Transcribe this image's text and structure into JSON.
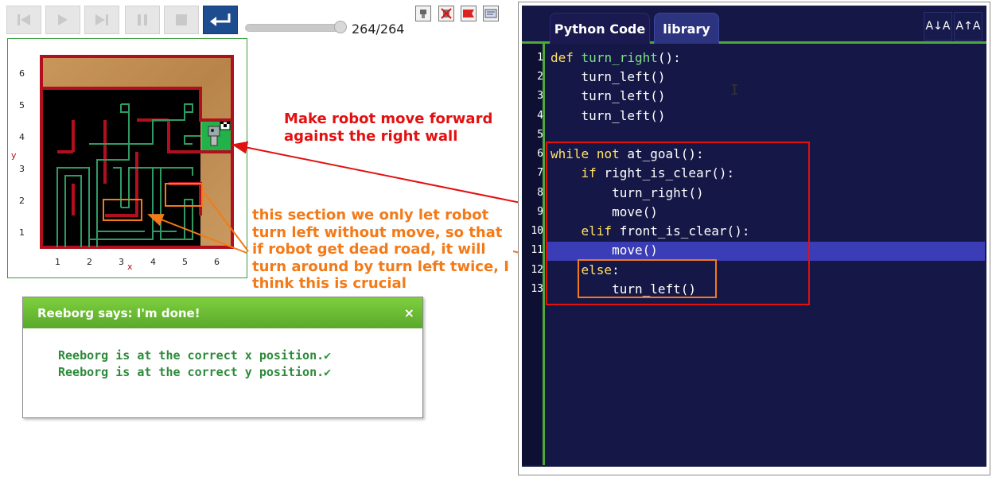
{
  "toolbar": {
    "buttons": [
      "reverse-step",
      "run",
      "step",
      "pause",
      "stop",
      "replay-enter"
    ],
    "slider": {
      "max": 264,
      "value": 264
    },
    "step_counter": "264/264",
    "mini_icons": [
      "robot-icon",
      "delete-robot-icon",
      "red-flag-icon",
      "world-info-icon"
    ]
  },
  "world": {
    "x_labels": [
      "1",
      "2",
      "3",
      "4",
      "5",
      "6"
    ],
    "y_labels": [
      "1",
      "2",
      "3",
      "4",
      "5",
      "6"
    ],
    "x_axis": "x",
    "y_axis": "y"
  },
  "annotations": {
    "red": [
      "Make robot move forward",
      "against the right wall"
    ],
    "orange": [
      "this section we only let robot",
      "turn left without move, so that",
      "if robot get dead road, it will",
      "turn around by turn left twice, I",
      "think this is crucial"
    ]
  },
  "dialog": {
    "title": "Reeborg says: I'm done!",
    "close": "×",
    "lines": [
      "Reeborg is at the correct x position.",
      "Reeborg is at the correct y position."
    ],
    "check": "✔"
  },
  "editor": {
    "tabs": {
      "python": "Python Code",
      "library": "library"
    },
    "font_decrease": "A↓A",
    "font_increase": "A↑A",
    "highlighted_line": 11,
    "lines": [
      "def turn_right():",
      "    turn_left()",
      "    turn_left()",
      "    turn_left()",
      "",
      "while not at_goal():",
      "    if right_is_clear():",
      "        turn_right()",
      "        move()",
      "    elif front_is_clear():",
      "        move()",
      "    else:",
      "        turn_left()"
    ]
  },
  "colors": {
    "accent_green": "#4ea83a",
    "editor_bg": "#151846",
    "annotation_red": "#e31010",
    "annotation_orange": "#f37a18"
  }
}
